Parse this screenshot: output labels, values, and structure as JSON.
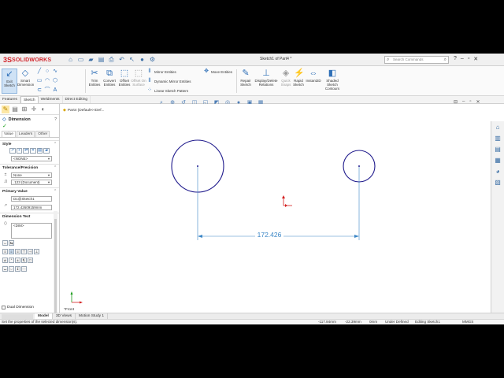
{
  "app": {
    "logo_text": "SOLIDWORKS",
    "document_title": "Sketch1 of Part4 *",
    "search_placeholder": "Search Commands"
  },
  "ribbon": {
    "exit_sketch": "Exit Sketch",
    "smart_dimension": "Smart Dimension",
    "trim_entities": "Trim Entities",
    "convert_entities": "Convert Entities",
    "offset_entities": "Offset Entities",
    "offset_on_surface": "Offset On Surface",
    "mirror_entities": "Mirror Entities",
    "dynamic_mirror_entities": "Dynamic Mirror Entities",
    "linear_sketch_pattern": "Linear Sketch Pattern",
    "move_entities": "Move Entities",
    "repair_sketch": "Repair Sketch",
    "display_delete_relations": "Display/Delete Relations",
    "quick_snaps": "Quick Snaps",
    "rapid_sketch": "Rapid Sketch",
    "instant2d": "Instant2D",
    "shaded_sketch_contours": "Shaded Sketch Contours"
  },
  "command_tabs": [
    "Features",
    "Sketch",
    "Weldments",
    "Direct Editing"
  ],
  "active_command_tab": "Sketch",
  "property_manager": {
    "title": "Dimension",
    "help": "?",
    "tabs": [
      "Value",
      "Leaders",
      "Other"
    ],
    "style_heading": "Style",
    "style_value": "<NONE>",
    "tolerance_heading": "Tolerance/Precision",
    "tolerance_type": "None",
    "precision": ".123 (Document)",
    "primary_value_heading": "Primary Value",
    "dimension_name": "D1@Sketch1",
    "dimension_value": "172.42609159mm",
    "dimension_text_heading": "Dimension Text",
    "dimension_text_value": "<DIM>",
    "dual_dimension": "Dual Dimension"
  },
  "graphics": {
    "breadcrumb": "Part4 (Default<<Def...",
    "dimension_label": "172.426",
    "view_label": "*Front"
  },
  "bottom_tabs": [
    "Model",
    "3D Views",
    "Motion Study 1"
  ],
  "active_bottom_tab": "Model",
  "status": {
    "message": "Set the properties of the selected dimension(s).",
    "x": "-117.84mm",
    "y": "-22.39mm",
    "z": "0mm",
    "definition": "Under Defined",
    "editing": "Editing Sketch1",
    "units": "MMGS"
  },
  "colors": {
    "accent": "#2e6fb7",
    "circle": "#1f1a8c",
    "dimension": "#3b86c6",
    "origin": "#d42020",
    "logo": "#d2232a"
  }
}
